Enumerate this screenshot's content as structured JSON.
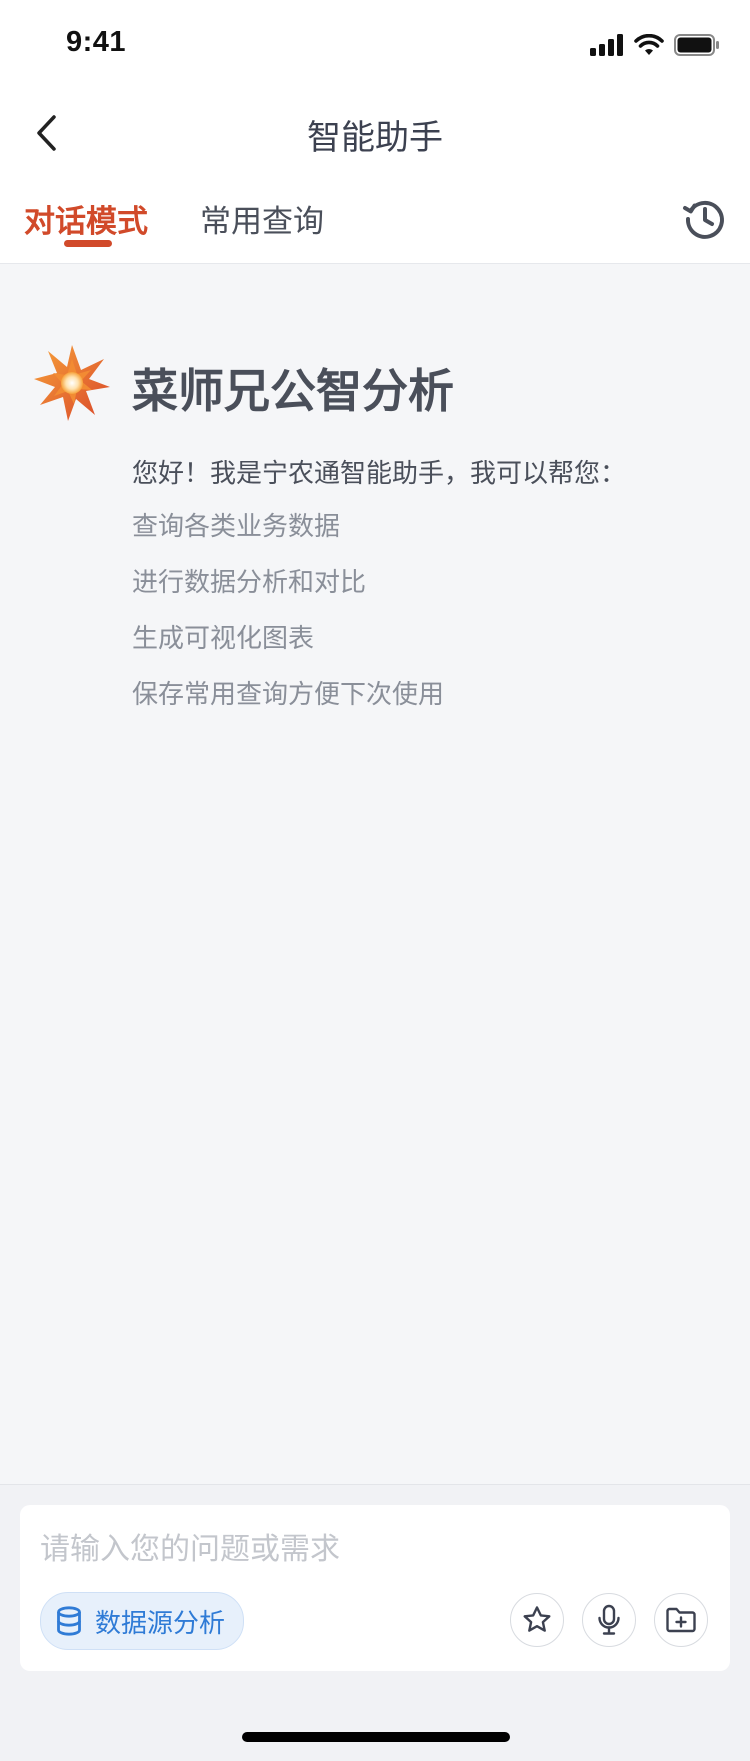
{
  "status_bar": {
    "time": "9:41"
  },
  "nav": {
    "title": "智能助手"
  },
  "tabs": [
    {
      "label": "对话模式",
      "active": true
    },
    {
      "label": "常用查询",
      "active": false
    }
  ],
  "welcome": {
    "title": "菜师兄公智分析",
    "greeting": "您好！我是宁农通智能助手，我可以帮您：",
    "capabilities": [
      "查询各类业务数据",
      "进行数据分析和对比",
      "生成可视化图表",
      "保存常用查询方便下次使用"
    ]
  },
  "input": {
    "placeholder": "请输入您的问题或需求",
    "value": "",
    "datasource_label": "数据源分析"
  },
  "icons": {
    "back": "chevron-left-icon",
    "history": "history-icon",
    "logo": "star-burst-logo",
    "datasource": "database-icon",
    "favorite": "star-icon",
    "voice": "microphone-icon",
    "attach": "folder-add-icon"
  },
  "colors": {
    "accent": "#D14A2A",
    "link_blue": "#2F7BD6",
    "background": "#F5F6F8",
    "text_primary": "#4A4F5A",
    "text_secondary": "#8A8F99"
  }
}
